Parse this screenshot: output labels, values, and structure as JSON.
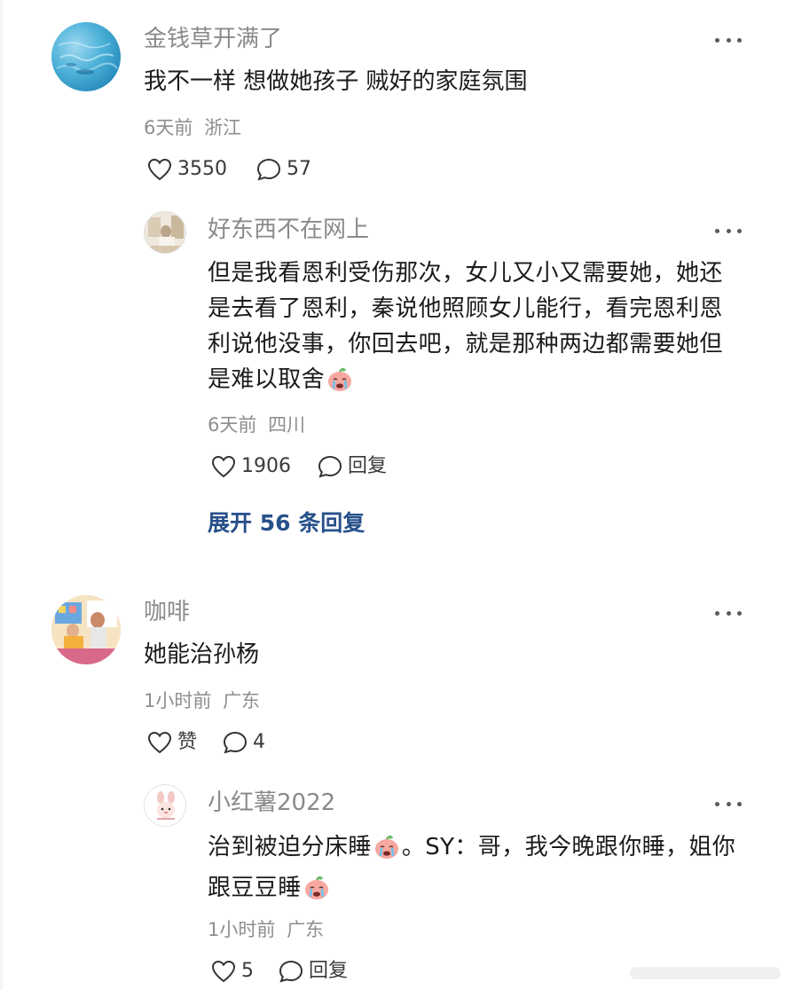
{
  "comments": [
    {
      "author": "金钱草开满了",
      "text": "我不一样 想做她孩子 贼好的家庭氛围",
      "time": "6天前",
      "location": "浙江",
      "likes": "3550",
      "replies_count": "57",
      "avatar_icon": "sea-water-avatar",
      "reply": {
        "author": "好东西不在网上",
        "text": "但是我看恩利受伤那次，女儿又小又需要她，她还是去看了恩利，秦说他照顾女儿能行，看完恩利恩利说他没事，你回去吧，就是那种两边都需要她但是难以取舍",
        "time": "6天前",
        "location": "四川",
        "likes": "1906",
        "reply_label": "回复",
        "avatar_icon": "room-photo-avatar"
      },
      "expand_label": "展开 56 条回复"
    },
    {
      "author": "咖啡",
      "text": "她能治孙杨",
      "time": "1小时前",
      "location": "广东",
      "likes": "赞",
      "replies_count": "4",
      "avatar_icon": "tv-show-avatar",
      "reply": {
        "author": "小红薯2022",
        "text_part1": "治到被迫分床睡",
        "text_part2": "。SY：哥，我今晚跟你睡，姐你跟豆豆睡",
        "time": "1小时前",
        "location": "广东",
        "likes": "5",
        "reply_label": "回复",
        "avatar_icon": "cartoon-avatar"
      }
    }
  ],
  "icons": {
    "like": "heart-outline-icon",
    "comment": "speech-bubble-icon",
    "more": "more-dots-icon",
    "emoji": "crying-face-emoji"
  },
  "colors": {
    "link": "#27508a",
    "meta": "#8e8e8e",
    "name": "#8a8a8a"
  }
}
